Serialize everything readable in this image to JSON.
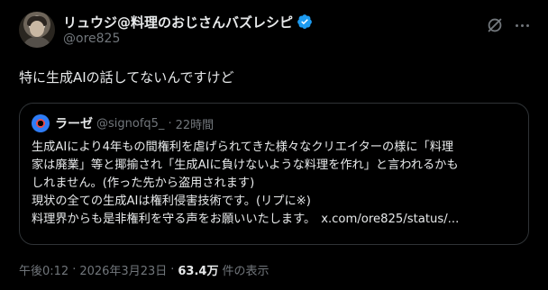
{
  "author": {
    "display_name": "リュウジ@料理のおじさんバズレシピ",
    "handle": "@ore825",
    "verified_color": "#1d9bf0"
  },
  "tweet": {
    "text": "特に生成AIの話してないんですけど"
  },
  "quote": {
    "display_name": "ラーゼ",
    "handle": "@signofq5_",
    "separator": "·",
    "time": "22時間",
    "lines": [
      "生成AIにより4年もの間権利を虐げられてきた様々なクリエイターの様に「料理",
      "家は廃業」等と揶揄され「生成AIに負けないような料理を作れ」と言われるかも",
      "しれません。(作った先から盗用されます)",
      "現状の全ての生成AIは権利侵害技術です。(リプに※)",
      "料理界からも是非権利を守る声をお願いいたします。"
    ],
    "link": "x.com/ore825/status/..."
  },
  "meta": {
    "time": "午後0:12",
    "dot1": "·",
    "date": "2026年3月23日",
    "dot2": "·",
    "views": "63.4万",
    "views_label": "件の表示"
  },
  "icons": {
    "avatar": "user-avatar",
    "verified": "verified-badge-icon",
    "grok": "grok-icon",
    "more": "more-options-icon",
    "quote_avatar": "quote-user-avatar"
  }
}
